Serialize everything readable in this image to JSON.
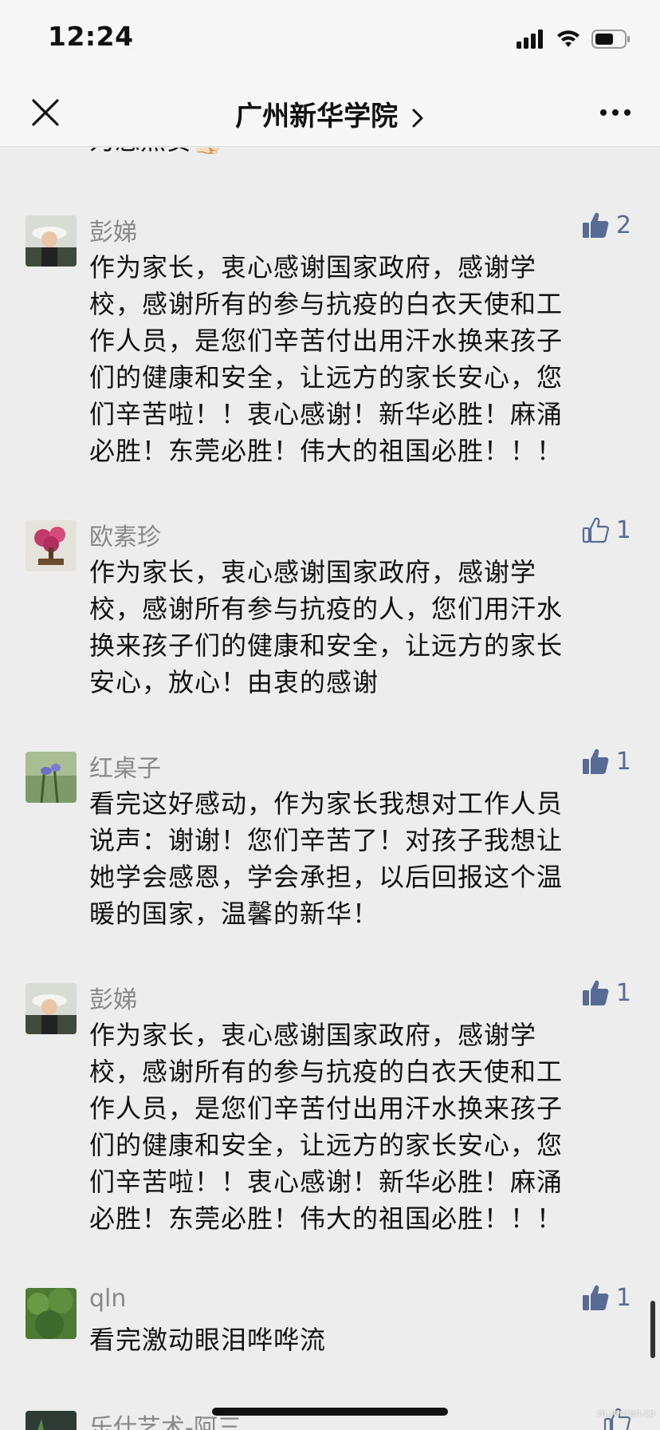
{
  "status": {
    "time": "12:24"
  },
  "nav": {
    "title": "广州新华学院"
  },
  "partial_text": "为您点赞👍🏻",
  "comments": [
    {
      "author": "彭娣",
      "likes": "2",
      "liked": true,
      "text": "作为家长，衷心感谢国家政府，感谢学\n校，感谢所有的参与抗疫的白衣天使和工\n作人员，是您们辛苦付出用汗水换来孩子\n们的健康和安全，让远方的家长安心，您\n们辛苦啦！！衷心感谢！新华必胜！麻涌\n必胜！东莞必胜！伟大的祖国必胜！！！"
    },
    {
      "author": "欧素珍",
      "likes": "1",
      "liked": false,
      "text": "作为家长，衷心感谢国家政府，感谢学\n校，感谢所有参与抗疫的人，您们用汗水\n换来孩子们的健康和安全，让远方的家长\n安心，放心！由衷的感谢"
    },
    {
      "author": "红桌子",
      "likes": "1",
      "liked": true,
      "text": "看完这好感动，作为家长我想对工作人员\n说声：谢谢！您们辛苦了！对孩子我想让\n她学会感恩，学会承担，以后回报这个温\n暖的国家，温馨的新华！"
    },
    {
      "author": "彭娣",
      "likes": "1",
      "liked": true,
      "text": "作为家长，衷心感谢国家政府，感谢学\n校，感谢所有的参与抗疫的白衣天使和工\n作人员，是您们辛苦付出用汗水换来孩子\n们的健康和安全，让远方的家长安心，您\n们辛苦啦！！衷心感谢！新华必胜！麻涌\n必胜！东莞必胜！伟大的祖国必胜！！！"
    },
    {
      "author": "qln",
      "likes": "1",
      "liked": true,
      "text": "看完激动眼泪哗哗流"
    },
    {
      "author": "乐仕艺术-阿三",
      "likes": "",
      "liked": false,
      "text": ""
    }
  ],
  "watermark": "m.renren.co",
  "colors": {
    "like_blue": "#576b95",
    "background": "#ededed",
    "bar": "#f7f7f7"
  }
}
